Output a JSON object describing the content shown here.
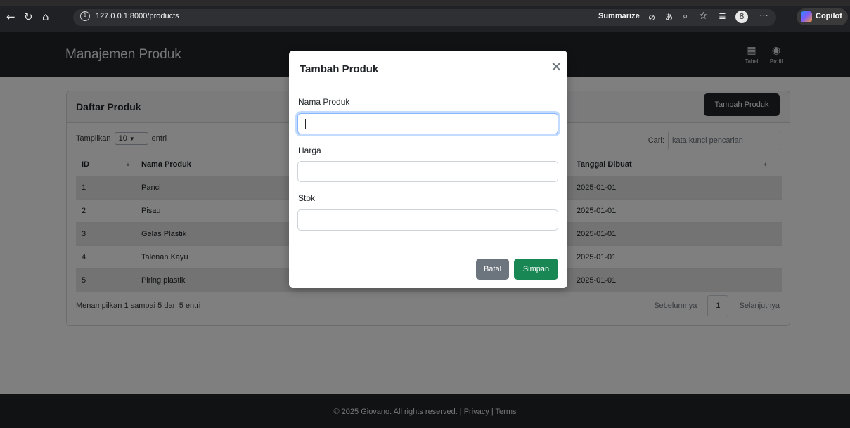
{
  "browser": {
    "url": "127.0.0.1:8000/products",
    "summarize_label": "Summarize",
    "copilot_label": "Copilot",
    "profile_initial": "8"
  },
  "navbar": {
    "brand": "Manajemen Produk",
    "items": [
      {
        "label": "Tabel",
        "icon": "table-icon"
      },
      {
        "label": "Profil",
        "icon": "user-circle-icon"
      }
    ]
  },
  "card": {
    "title": "Daftar Produk",
    "add_button": "Tambah Produk",
    "length": {
      "prefix": "Tampilkan",
      "value": "10",
      "suffix": "entri"
    },
    "search": {
      "label": "Cari:",
      "placeholder": "kata kunci pencarian"
    },
    "columns": [
      "ID",
      "Nama Produk",
      "Tanggal Dibuat"
    ],
    "rows": [
      {
        "id": "1",
        "name": "Panci",
        "date": "2025-01-01"
      },
      {
        "id": "2",
        "name": "Pisau",
        "date": "2025-01-01"
      },
      {
        "id": "3",
        "name": "Gelas Plastik",
        "date": "2025-01-01"
      },
      {
        "id": "4",
        "name": "Talenan Kayu",
        "date": "2025-01-01"
      },
      {
        "id": "5",
        "name": "Piring plastik",
        "date": "2025-01-01"
      }
    ],
    "info": "Menampilkan 1 sampai 5 dari 5 entri",
    "pager": {
      "prev": "Sebelumnya",
      "page": "1",
      "next": "Selanjutnya"
    }
  },
  "footer": "© 2025 Giovano. All rights reserved. | Privacy | Terms",
  "modal": {
    "title": "Tambah Produk",
    "fields": [
      {
        "label": "Nama Produk",
        "value": ""
      },
      {
        "label": "Harga",
        "value": ""
      },
      {
        "label": "Stok",
        "value": ""
      }
    ],
    "cancel_label": "Batal",
    "save_label": "Simpan"
  },
  "colors": {
    "navbar": "#212529",
    "save_button": "#198754",
    "cancel_button": "#6c757d",
    "focus_ring": "#86b7fe"
  }
}
